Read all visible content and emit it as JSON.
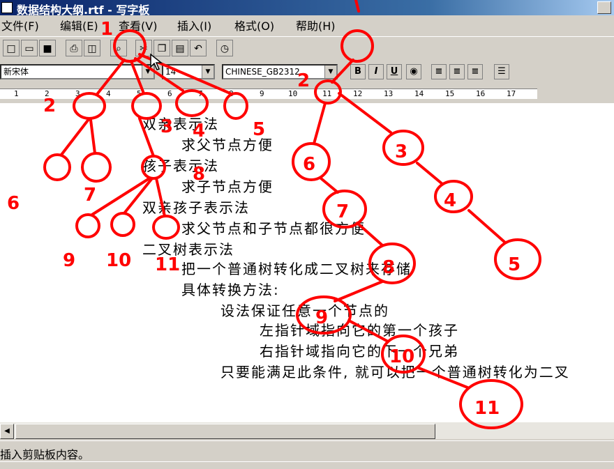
{
  "window": {
    "title": "数据结构大纲.rtf - 写字板"
  },
  "menu": [
    "文件(F)",
    "编辑(E)",
    "查看(V)",
    "插入(I)",
    "格式(O)",
    "帮助(H)"
  ],
  "format": {
    "font": "新宋体",
    "size": "14",
    "script": "CHINESE_GB2312",
    "bold": "B",
    "italic": "I",
    "underline": "U"
  },
  "ruler": [
    "1",
    "2",
    "3",
    "4",
    "5",
    "6",
    "7",
    "8",
    "9",
    "10",
    "11",
    "12",
    "13",
    "14",
    "15",
    "16",
    "17"
  ],
  "document": {
    "lines": [
      "双亲表示法",
      "求父节点方便",
      "孩子表示法",
      "求子节点方便",
      "双亲孩子表示法",
      "求父节点和子节点都很方便",
      "二叉树表示法",
      "把一个普通树转化成二叉树来存储",
      "具体转换方法:",
      "设法保证任意一个节点的",
      "左指针域指向它的第一个孩子",
      "右指针域指向它的下一个兄弟",
      "只要能满足此条件, 就可以把一个普通树转化为二叉"
    ]
  },
  "status": {
    "text": "插入剪贴板内容。"
  },
  "annotations": {
    "color": "#ff0000",
    "labels": [
      "1",
      "2",
      "3",
      "4",
      "5",
      "6",
      "7",
      "8",
      "9",
      "10",
      "11",
      "2",
      "3",
      "4",
      "5",
      "6",
      "7",
      "8",
      "9",
      "10",
      "11"
    ]
  }
}
